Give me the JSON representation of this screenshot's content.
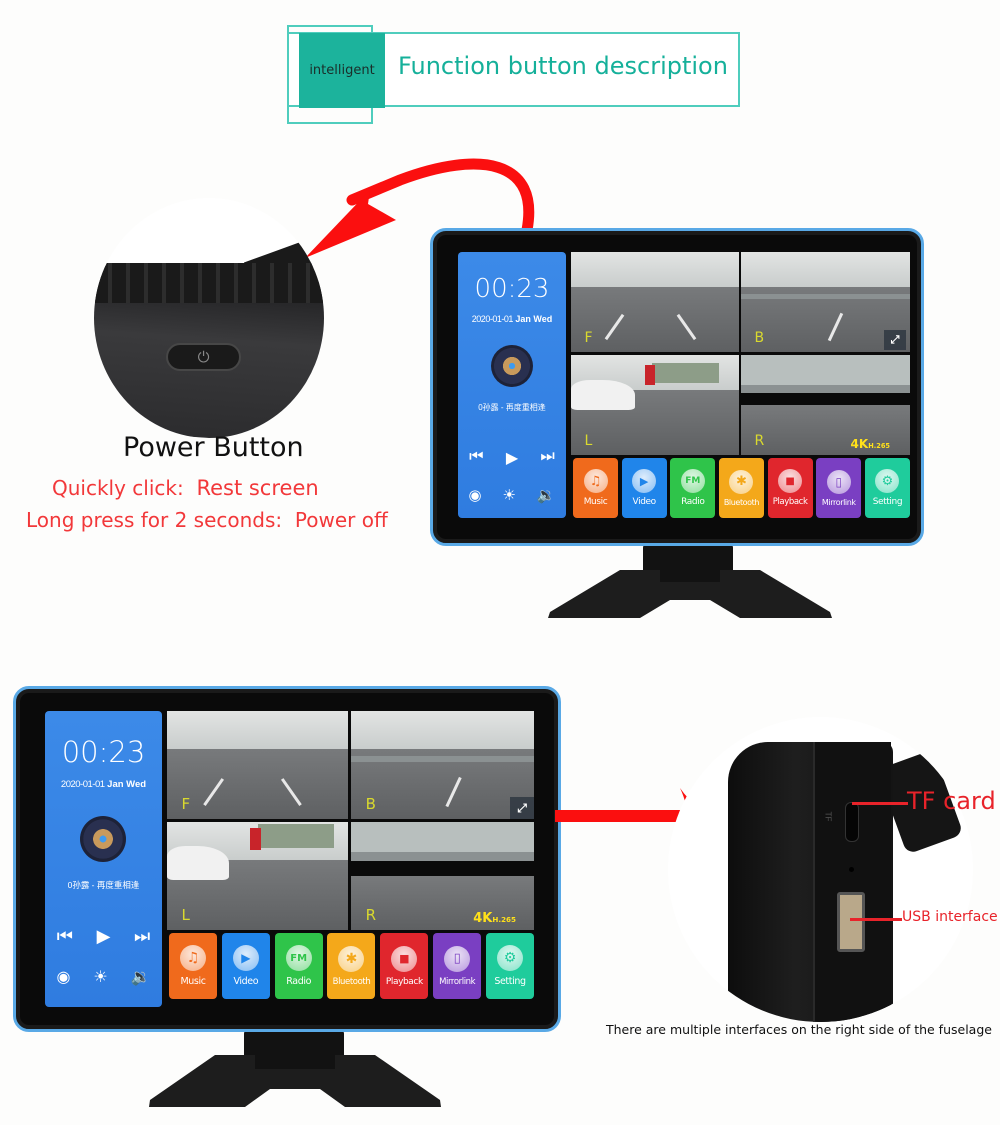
{
  "header": {
    "tag": "intelligent",
    "title": "Function button description"
  },
  "power_button": {
    "title": "Power Button",
    "quick_click_label": "Quickly click:",
    "quick_click_action": "Rest screen",
    "long_press_label": "Long press for 2 seconds:",
    "long_press_action": "Power off",
    "icon": "power-icon"
  },
  "device_ui": {
    "clock": "00:23",
    "date": "2020-01-01",
    "date_text": "Jan Wed",
    "song": "0孙露 - 再度重相逢",
    "player_controls": [
      "previous-icon",
      "play-icon",
      "next-icon"
    ],
    "system_controls": [
      "record-icon",
      "brightness-icon",
      "volume-icon"
    ],
    "cameras": [
      {
        "label": "F"
      },
      {
        "label": "B"
      },
      {
        "label": "L"
      },
      {
        "label": "R"
      }
    ],
    "resolution_badge": "4K",
    "codec_badge": "H.265",
    "fullscreen_icon": "fullscreen-icon",
    "apps": [
      {
        "label": "Music",
        "icon": "♫",
        "color": "#f06a1c"
      },
      {
        "label": "Video",
        "icon": "▶",
        "color": "#2085ea"
      },
      {
        "label": "Radio",
        "icon": "FM",
        "color": "#2fc44a"
      },
      {
        "label": "Bluetooth",
        "icon": "✱",
        "color": "#f4a81a"
      },
      {
        "label": "Playback",
        "icon": "■",
        "color": "#e0262d"
      },
      {
        "label": "Mirrorlink",
        "icon": "▯",
        "color": "#7a3fc2"
      },
      {
        "label": "Setting",
        "icon": "⚙",
        "color": "#1fcc9c"
      }
    ]
  },
  "interfaces": {
    "tf_card_label": "TF card",
    "usb_label": "USB interface",
    "tf_slot_text": "TF",
    "caption": "There are multiple interfaces on the right side of the fuselage"
  },
  "colors": {
    "teal_accent": "#1cb39c",
    "annotation_red": "#f2383a",
    "bezel_blue": "#59a9e6"
  }
}
